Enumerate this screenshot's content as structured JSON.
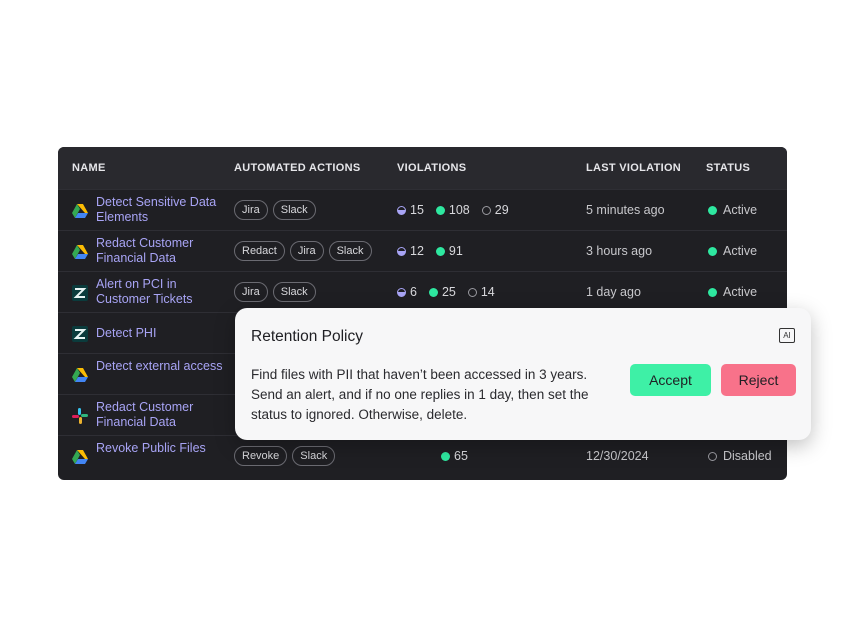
{
  "table": {
    "headers": {
      "name": "NAME",
      "actions": "AUTOMATED ACTIONS",
      "violations": "VIOLATIONS",
      "last": "LAST VIOLATION",
      "status": "STATUS"
    },
    "rows": [
      {
        "icon": "google-drive-icon",
        "name": "Detect Sensitive Data Elements",
        "actions": [
          "Jira",
          "Slack"
        ],
        "violations": {
          "half": "15",
          "green": "108",
          "ring": "29"
        },
        "last": "5 minutes ago",
        "status": "Active"
      },
      {
        "icon": "google-drive-icon",
        "name": "Redact Customer Financial Data",
        "actions": [
          "Redact",
          "Jira",
          "Slack"
        ],
        "violations": {
          "half": "12",
          "green": "91"
        },
        "last": "3 hours ago",
        "status": "Active"
      },
      {
        "icon": "zendesk-icon",
        "name": "Alert on PCI in Customer Tickets",
        "actions": [
          "Jira",
          "Slack"
        ],
        "violations": {
          "half": "6",
          "green": "25",
          "ring": "14"
        },
        "last": "1 day ago",
        "status": "Active"
      },
      {
        "icon": "zendesk-icon",
        "name": "Detect PHI"
      },
      {
        "icon": "google-drive-icon",
        "name": "Detect external access"
      },
      {
        "icon": "slack-icon",
        "name": "Redact Customer Financial Data"
      },
      {
        "icon": "google-drive-icon",
        "name": "Revoke Public Files",
        "actions": [
          "Revoke",
          "Slack"
        ],
        "violations": {
          "green": "65"
        },
        "last": "12/30/2024",
        "status": "Disabled"
      }
    ]
  },
  "popup": {
    "title": "Retention Policy",
    "badge": "AI",
    "body": "Find files with PII that haven’t been accessed in 3 years. Send an alert, and if no one replies in 1 day, then set the status to ignored. Otherwise, delete.",
    "accept_label": "Accept",
    "reject_label": "Reject"
  },
  "colors": {
    "accent": "#a8a4f5",
    "active": "#2ee8a0",
    "accept": "#3ef0a6",
    "reject": "#f8728a"
  }
}
